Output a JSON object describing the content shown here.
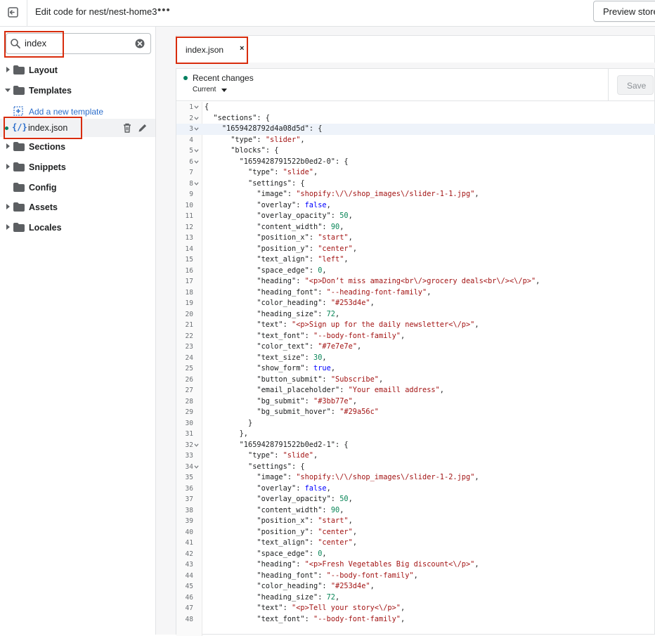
{
  "topbar": {
    "title": "Edit code for nest/nest-home3",
    "more_label": "•••",
    "preview_label": "Preview store"
  },
  "sidebar": {
    "search_value": "index",
    "items": [
      {
        "label": "Layout",
        "expanded": false
      },
      {
        "label": "Templates",
        "expanded": true
      },
      {
        "label": "Sections",
        "expanded": false
      },
      {
        "label": "Snippets",
        "expanded": false
      },
      {
        "label": "Config",
        "expanded": false
      },
      {
        "label": "Assets",
        "expanded": false
      },
      {
        "label": "Locales",
        "expanded": false
      }
    ],
    "add_template_label": "Add a new template",
    "file_icon_text": "{/}",
    "file_label": "index.json"
  },
  "tab": {
    "label": "index.json",
    "close_label": "×"
  },
  "editor": {
    "recent_label": "Recent changes",
    "current_label": "Current",
    "save_label": "Save"
  },
  "code_lines": [
    {
      "n": "1",
      "t": "{",
      "fold": true
    },
    {
      "n": "2",
      "t": "  \"sections\": {",
      "fold": true
    },
    {
      "n": "3",
      "t": "    \"1659428792d4a08d5d\": {",
      "fold": true,
      "active": true
    },
    {
      "n": "4",
      "t": "      \"type\": \"slider\","
    },
    {
      "n": "5",
      "t": "      \"blocks\": {",
      "fold": true
    },
    {
      "n": "6",
      "t": "        \"1659428791522b0ed2-0\": {",
      "fold": true
    },
    {
      "n": "7",
      "t": "          \"type\": \"slide\","
    },
    {
      "n": "8",
      "t": "          \"settings\": {",
      "fold": true
    },
    {
      "n": "9",
      "t": "            \"image\": \"shopify:\\/\\/shop_images\\/slider-1-1.jpg\","
    },
    {
      "n": "10",
      "t": "            \"overlay\": false,"
    },
    {
      "n": "11",
      "t": "            \"overlay_opacity\": 50,"
    },
    {
      "n": "12",
      "t": "            \"content_width\": 90,"
    },
    {
      "n": "13",
      "t": "            \"position_x\": \"start\","
    },
    {
      "n": "14",
      "t": "            \"position_y\": \"center\","
    },
    {
      "n": "15",
      "t": "            \"text_align\": \"left\","
    },
    {
      "n": "16",
      "t": "            \"space_edge\": 0,"
    },
    {
      "n": "17",
      "t": "            \"heading\": \"<p>Don’t miss amazing<br\\/>grocery deals<br\\/><\\/p>\","
    },
    {
      "n": "18",
      "t": "            \"heading_font\": \"--heading-font-family\","
    },
    {
      "n": "19",
      "t": "            \"color_heading\": \"#253d4e\","
    },
    {
      "n": "20",
      "t": "            \"heading_size\": 72,"
    },
    {
      "n": "21",
      "t": "            \"text\": \"<p>Sign up for the daily newsletter<\\/p>\","
    },
    {
      "n": "22",
      "t": "            \"text_font\": \"--body-font-family\","
    },
    {
      "n": "23",
      "t": "            \"color_text\": \"#7e7e7e\","
    },
    {
      "n": "24",
      "t": "            \"text_size\": 30,"
    },
    {
      "n": "25",
      "t": "            \"show_form\": true,"
    },
    {
      "n": "26",
      "t": "            \"button_submit\": \"Subscribe\","
    },
    {
      "n": "27",
      "t": "            \"email_placeholder\": \"Your emaill address\","
    },
    {
      "n": "28",
      "t": "            \"bg_submit\": \"#3bb77e\","
    },
    {
      "n": "29",
      "t": "            \"bg_submit_hover\": \"#29a56c\""
    },
    {
      "n": "30",
      "t": "          }"
    },
    {
      "n": "31",
      "t": "        },"
    },
    {
      "n": "32",
      "t": "        \"1659428791522b0ed2-1\": {",
      "fold": true
    },
    {
      "n": "33",
      "t": "          \"type\": \"slide\","
    },
    {
      "n": "34",
      "t": "          \"settings\": {",
      "fold": true
    },
    {
      "n": "35",
      "t": "            \"image\": \"shopify:\\/\\/shop_images\\/slider-1-2.jpg\","
    },
    {
      "n": "36",
      "t": "            \"overlay\": false,"
    },
    {
      "n": "37",
      "t": "            \"overlay_opacity\": 50,"
    },
    {
      "n": "38",
      "t": "            \"content_width\": 90,"
    },
    {
      "n": "39",
      "t": "            \"position_x\": \"start\","
    },
    {
      "n": "40",
      "t": "            \"position_y\": \"center\","
    },
    {
      "n": "41",
      "t": "            \"text_align\": \"center\","
    },
    {
      "n": "42",
      "t": "            \"space_edge\": 0,"
    },
    {
      "n": "43",
      "t": "            \"heading\": \"<p>Fresh Vegetables Big discount<\\/p>\","
    },
    {
      "n": "44",
      "t": "            \"heading_font\": \"--body-font-family\","
    },
    {
      "n": "45",
      "t": "            \"color_heading\": \"#253d4e\","
    },
    {
      "n": "46",
      "t": "            \"heading_size\": 72,"
    },
    {
      "n": "47",
      "t": "            \"text\": \"<p>Tell your story<\\/p>\","
    },
    {
      "n": "48",
      "t": "            \"text_font\": \"--body-font-family\","
    }
  ],
  "colors": {
    "highlight": "#d82c0d",
    "link": "#2c6ecb",
    "string": "#a31515",
    "number": "#098658",
    "boolean": "#0000ff",
    "status_dot": "#007f5f"
  }
}
